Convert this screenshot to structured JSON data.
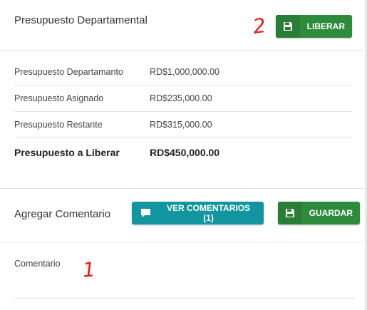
{
  "header": {
    "title": "Presupuesto Departamental",
    "liberar_label": "LIBERAR"
  },
  "budget": {
    "rows": [
      {
        "label": "Presupuesto Departamanto",
        "value": "RD$1,000,000.00"
      },
      {
        "label": "Presupuesto Asignado",
        "value": "RD$235,000.00"
      },
      {
        "label": "Presupuesto Restante",
        "value": "RD$315,000.00"
      }
    ],
    "total": {
      "label": "Presupuesto a Liberar",
      "value": "RD$450,000.00"
    }
  },
  "comment_section": {
    "title": "Agregar Comentario",
    "ver_comentarios_label": "VER COMENTARIOS (1)",
    "guardar_label": "GUARDAR",
    "field_label": "Comentario",
    "field_value": ""
  },
  "annotations": {
    "mark_1": "1",
    "mark_2": "2"
  },
  "colors": {
    "green_button": "#2e8b3c",
    "teal_button": "#12959f",
    "annotation_red": "#e0201a"
  },
  "icons": {
    "liberar": "floppy-disk-icon",
    "guardar": "floppy-disk-icon",
    "ver_comentarios": "speech-bubble-icon"
  }
}
